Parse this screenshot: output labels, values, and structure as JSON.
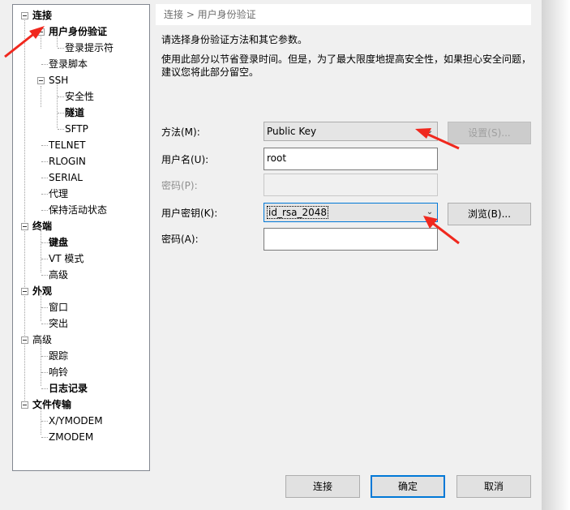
{
  "breadcrumb": "连接 > 用户身份验证",
  "intro": {
    "line1": "请选择身份验证方法和其它参数。",
    "line2": "使用此部分以节省登录时间。但是，为了最大限度地提高安全性，如果担心安全问题，",
    "line3": "建议您将此部分留空。"
  },
  "tree": {
    "connection": "连接",
    "user_auth": "用户身份验证",
    "login_prompt": "登录提示符",
    "login_script": "登录脚本",
    "ssh": "SSH",
    "security": "安全性",
    "tunnel": "隧道",
    "sftp": "SFTP",
    "telnet": "TELNET",
    "rlogin": "RLOGIN",
    "serial": "SERIAL",
    "proxy": "代理",
    "keepalive": "保持活动状态",
    "terminal": "终端",
    "keyboard": "键盘",
    "vt_mode": "VT 模式",
    "advanced_term": "高级",
    "appearance": "外观",
    "window": "窗口",
    "highlight": "突出",
    "advanced": "高级",
    "trace": "跟踪",
    "bell": "响铃",
    "logging": "日志记录",
    "file_transfer": "文件传输",
    "xymodem": "X/YMODEM",
    "zmodem": "ZMODEM"
  },
  "form": {
    "method_label": "方法(M):",
    "method_value": "Public Key",
    "settings_button": "设置(S)...",
    "username_label": "用户名(U):",
    "username_value": "root",
    "password_label_disabled": "密码(P):",
    "password_value": "",
    "user_key_label": "用户密钥(K):",
    "user_key_value": "id_rsa_2048",
    "browse_button": "浏览(B)...",
    "passphrase_label": "密码(A):",
    "passphrase_value": ""
  },
  "buttons": {
    "connect": "连接",
    "ok": "确定",
    "cancel": "取消"
  },
  "colors": {
    "annotation_arrow": "#f0281e",
    "focus_border": "#0078d7"
  }
}
